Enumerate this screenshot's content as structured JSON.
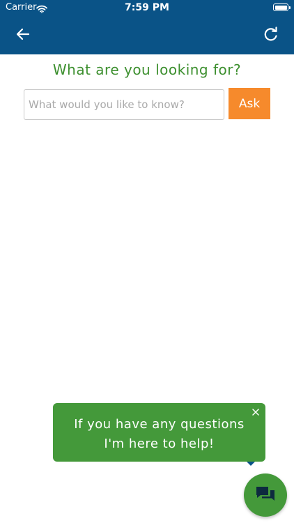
{
  "status_bar": {
    "carrier": "Carrier",
    "time": "7:59 PM"
  },
  "header": {
    "back_icon": "arrow-left-icon",
    "refresh_icon": "refresh-icon",
    "color": "#0a5387"
  },
  "main": {
    "title": "What are you looking for?",
    "search_placeholder": "What would you like to know?",
    "ask_label": "Ask",
    "title_color": "#3c8f2e",
    "ask_color": "#f68a2c"
  },
  "chat": {
    "tooltip_line1": "If you have any questions",
    "tooltip_line2": "I'm here to help!",
    "close_icon": "close-icon",
    "fab_icon": "chat-bubbles-icon",
    "color": "#44993a"
  }
}
